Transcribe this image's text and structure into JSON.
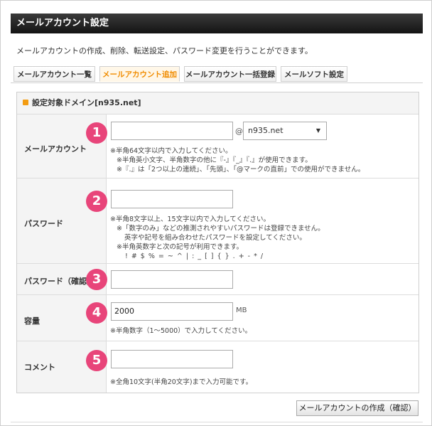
{
  "header": {
    "title": "メールアカウント設定"
  },
  "description": "メールアカウントの作成、削除、転送設定、パスワード変更を行うことができます。",
  "tabs": [
    {
      "label": "メールアカウント一覧",
      "active": false
    },
    {
      "label": "メールアカウント追加",
      "active": true
    },
    {
      "label": "メールアカウント一括登録",
      "active": false
    },
    {
      "label": "メールソフト設定",
      "active": false
    }
  ],
  "domain_header": "設定対象ドメイン[n935.net]",
  "form": {
    "account": {
      "label": "メールアカウント",
      "step": "1",
      "value": "",
      "at": "@",
      "domain_selected": "n935.net",
      "notes": [
        "※半角64文字以内で入力してください。",
        "※半角英小文字、半角数字の他に『-』『_』『.』が使用できます。",
        "※『.』は「2つ以上の連続」、「先頭」、「@マークの直前」での使用ができません。"
      ]
    },
    "password": {
      "label": "パスワード",
      "step": "2",
      "value": "",
      "notes": [
        "※半角8文字以上、15文字以内で入力してください。",
        "※「数字のみ」などの推測されやすいパスワードは登録できません。",
        "英字や記号を組み合わせたパスワードを設定してください。",
        "※半角英数字と次の記号が利用できます。",
        "! # $ % = ~ ^ | : _ [ ] { } . + - * /"
      ]
    },
    "password_confirm": {
      "label": "パスワード（確認）",
      "step": "3",
      "value": ""
    },
    "capacity": {
      "label": "容量",
      "step": "4",
      "value": "2000",
      "unit": "MB",
      "notes": [
        "※半角数字（1～5000）で入力してください。"
      ]
    },
    "comment": {
      "label": "コメント",
      "step": "5",
      "value": "",
      "notes": [
        "※全角10文字(半角20文字)まで入力可能です。"
      ]
    }
  },
  "submit_label": "メールアカウントの作成（確認）",
  "colors": {
    "accent": "#f08c00",
    "step_badge": "#e8457a",
    "title_bar": "#1e1e1e"
  }
}
